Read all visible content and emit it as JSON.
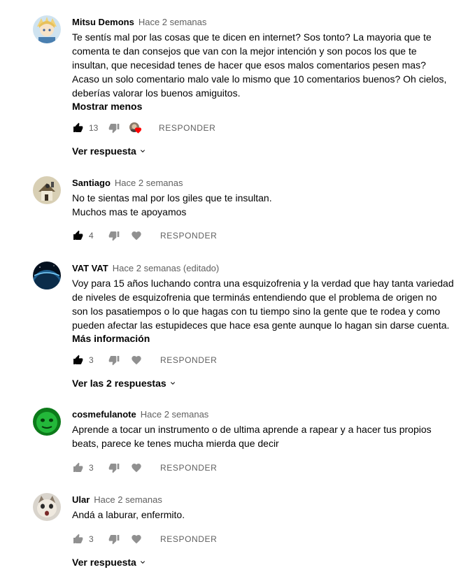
{
  "comments": [
    {
      "author": "Mitsu Demons",
      "time": "Hace 2 semanas",
      "text": "Te sentís mal por las cosas que te dicen en internet? Sos tonto? La mayoria que te\ncomenta te dan consejos que van con la mejor intención y son pocos los que te\ninsultan, que necesidad tenes de hacer que esos malos comentarios pesen mas?\nAcaso un solo comentario malo vale lo mismo que 10 comentarios buenos? Oh cielos,\ndeberías valorar los buenos amiguitos.",
      "more_label": "Mostrar menos",
      "likes": "13",
      "reply_label": "RESPONDER",
      "replies_label": "Ver respuesta",
      "avatar_icon": "anime-avatar-icon",
      "creator_heart": "creator-heart-icon"
    },
    {
      "author": "Santiago",
      "time": "Hace 2 semanas",
      "text": "No te sientas mal por los giles que te insultan.\nMuchos mas te apoyamos",
      "likes": "4",
      "reply_label": "RESPONDER",
      "avatar_icon": "house-avatar-icon"
    },
    {
      "author": "VAT VAT",
      "time": "Hace 2 semanas (editado)",
      "text": "Voy para 15 años luchando contra una esquizofrenia y la verdad que hay tanta variedad\nde niveles de esquizofrenia que terminás entendiendo que el problema de origen no\nson los pasatiempos o lo que hagas con tu tiempo sino la gente que te rodea y como\npueden afectar las estupideces que hace esa gente aunque lo hagan sin darse cuenta.",
      "more_label": "Más información",
      "likes": "3",
      "reply_label": "RESPONDER",
      "replies_label": "Ver las 2 respuestas",
      "avatar_icon": "planet-avatar-icon"
    },
    {
      "author": "cosmefulanote",
      "time": "Hace 2 semanas",
      "text": "Aprende a tocar un instrumento o de ultima aprende a rapear y a hacer tus propios\nbeats, parece ke tenes mucha mierda que decir",
      "likes": "3",
      "reply_label": "RESPONDER",
      "avatar_icon": "green-face-avatar-icon"
    },
    {
      "author": "Ular",
      "time": "Hace 2 semanas",
      "text": "Andá a laburar, enfermito.",
      "likes": "3",
      "reply_label": "RESPONDER",
      "replies_label": "Ver respuesta",
      "avatar_icon": "cat-avatar-icon"
    }
  ],
  "colors": {
    "text": "#030303",
    "secondary": "#606060",
    "icon": "#909090",
    "heart": "#ff0000"
  }
}
